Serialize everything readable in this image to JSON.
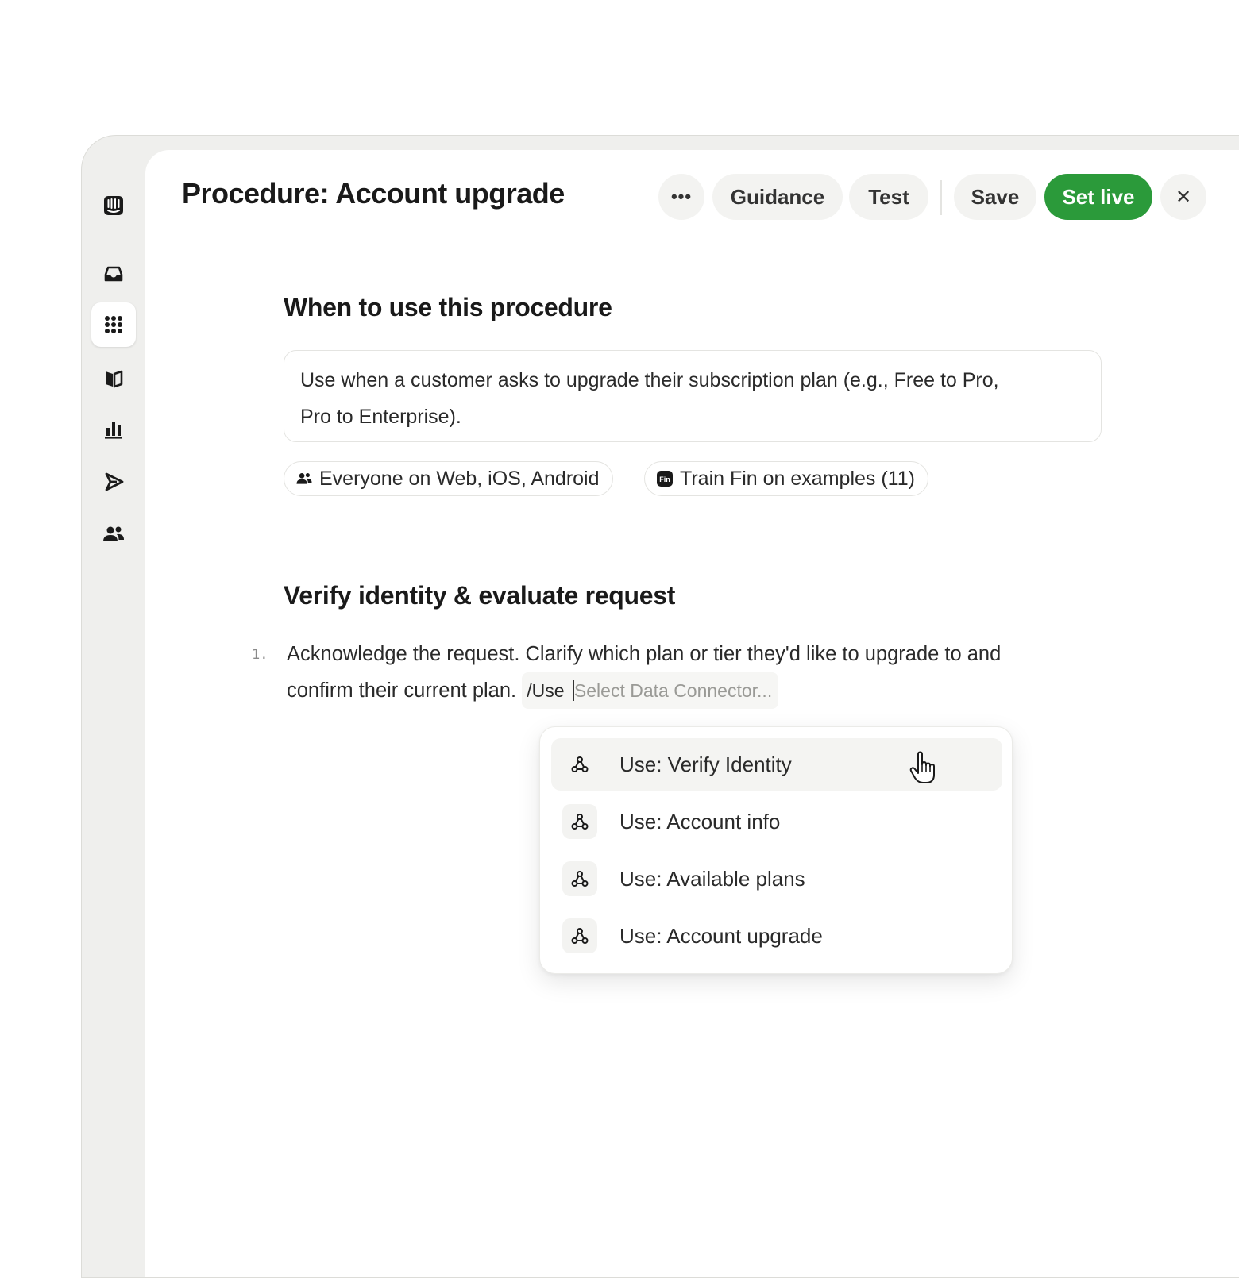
{
  "header": {
    "title": "Procedure: Account upgrade",
    "more_label": "•••",
    "guidance_label": "Guidance",
    "test_label": "Test",
    "save_label": "Save",
    "set_live_label": "Set live",
    "close_label": "✕"
  },
  "sidebar": {
    "items": [
      {
        "icon": "app-logo-icon"
      },
      {
        "icon": "inbox-icon"
      },
      {
        "icon": "apps-grid-icon",
        "active": true
      },
      {
        "icon": "book-icon"
      },
      {
        "icon": "bar-chart-icon"
      },
      {
        "icon": "send-icon"
      },
      {
        "icon": "people-icon"
      }
    ]
  },
  "when_section": {
    "title": "When to use this procedure",
    "description_line1": "Use when a customer asks to upgrade their subscription plan (e.g., Free to Pro,",
    "description_line2": "Pro to Enterprise).",
    "audience_chip": "Everyone on Web, iOS, Android",
    "train_chip": "Train Fin on examples (11)"
  },
  "verify_section": {
    "title": "Verify identity & evaluate request",
    "step_number": "1.",
    "step_line1": "Acknowledge the request. Clarify which plan or tier they'd like to upgrade to and",
    "step_line2": "confirm their current plan.",
    "command_text": "/Use",
    "command_placeholder": "Select Data Connector..."
  },
  "dropdown": {
    "items": [
      {
        "label": "Use: Verify Identity",
        "icon": "webhook-icon",
        "hovered": true
      },
      {
        "label": "Use: Account info",
        "icon": "webhook-icon"
      },
      {
        "label": "Use: Available plans",
        "icon": "webhook-icon"
      },
      {
        "label": "Use: Account upgrade",
        "icon": "webhook-icon"
      }
    ]
  },
  "colors": {
    "accent_green": "#2b9a3a",
    "rail_bg": "#efefed",
    "panel_bg": "#ffffff"
  }
}
